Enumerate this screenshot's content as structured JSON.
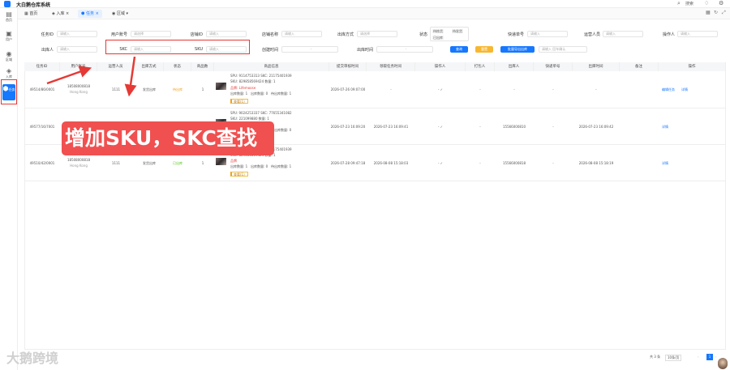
{
  "app": {
    "title": "大白鹅仓库系统",
    "search_label": "搜索"
  },
  "sidebar": {
    "items": [
      {
        "label": "首页",
        "icon": "home-icon"
      },
      {
        "label": "用户",
        "icon": "user-icon"
      },
      {
        "label": "区域",
        "icon": "location-icon"
      },
      {
        "label": "入库",
        "icon": "box-icon"
      },
      {
        "label": "任务",
        "icon": "task-icon"
      }
    ]
  },
  "tabs": [
    {
      "label": "首页",
      "icon": "grid-icon"
    },
    {
      "label": "入库",
      "icon": "box-icon"
    },
    {
      "label": "任务",
      "icon": "task-icon",
      "active": true
    },
    {
      "label": "区域",
      "icon": "location-icon"
    }
  ],
  "filters": {
    "row1": [
      {
        "label": "任务ID",
        "placeholder": "请输入"
      },
      {
        "label": "用户账号",
        "placeholder": "请选择"
      },
      {
        "label": "店铺ID",
        "placeholder": "请输入"
      },
      {
        "label": "店铺名称",
        "placeholder": "请输入"
      },
      {
        "label": "出库方式",
        "placeholder": "请选择"
      },
      {
        "label": "状态",
        "placeholder": ""
      },
      {
        "label": "快递单号",
        "placeholder": "请输入"
      },
      {
        "label": "运营人员",
        "placeholder": "请输入"
      },
      {
        "label": "操作人",
        "placeholder": "请输入"
      }
    ],
    "status_tags": [
      "待拣货",
      "待发货",
      "已出库"
    ],
    "row2": [
      {
        "label": "出库人",
        "placeholder": "请输入"
      },
      {
        "label": "SKC",
        "placeholder": "请输入"
      },
      {
        "label": "SKU",
        "placeholder": "请输入"
      },
      {
        "label": "创建时间",
        "placeholder": "-"
      },
      {
        "label": "出库时间",
        "placeholder": "-"
      }
    ],
    "search_button": "查询",
    "reset_button": "重置",
    "export_button": "批量导出出库",
    "extra_placeholder": "请输入 回车确认"
  },
  "table": {
    "headers": [
      "任务ID",
      "用户账号",
      "运营人员",
      "出库方式",
      "状态",
      "商品数",
      "商品信息",
      "提交审核时间",
      "领取任务时间",
      "操作人",
      "打包人",
      "出库人",
      "快递单号",
      "出库时间",
      "备注",
      "操作"
    ],
    "rows": [
      {
        "id": "49514/86/0001",
        "account": "18508000818",
        "account_sub": "Hong Kong",
        "operator": "1111",
        "method": "发货出库",
        "status": "待出库",
        "count": "1",
        "spu": "SPU: 9114753313",
        "skc": "SKC: 21175401939",
        "sku": "SKU: 829858569424",
        "qty": "数量: 1",
        "brand": "品牌: Lifemoose",
        "stock1": "出库数量: 1",
        "stock2": "出库数量: 0",
        "stock3": "待出库数量: 1",
        "note": "查看(1)",
        "submit": "2026-07-26 09:07:00",
        "claim": "-",
        "opr": "- ✓",
        "packer": "-",
        "outer": "-",
        "express": "-",
        "outtime": "-",
        "remark": "",
        "actions": [
          "编辑任务",
          "详情"
        ]
      },
      {
        "id": "49577/16/7001",
        "account": "18508000818",
        "account_sub": "Hong Kong",
        "operator": "1111",
        "method": "发货出库",
        "status": "已出库",
        "count": "1",
        "spu": "SPU: 9024253337",
        "skc": "SKC: 77655341082",
        "sku": "SKU: 221099880",
        "qty": "数量: 1",
        "brand": "品牌: Lifemoose",
        "stock1": "出库数量: 1",
        "stock2": "出库数量: 0",
        "stock3": "待出库数量: 0",
        "note": "查看详情",
        "submit": "2026-07-23 16:09:20",
        "claim": "2026-07-23 16:09:41",
        "opr": "- ✓",
        "packer": "-",
        "outer": "15566000810",
        "express": "-",
        "outtime": "2026-07-23 16:09:42",
        "remark": "",
        "actions": [
          "详情"
        ]
      },
      {
        "id": "49510/42/0001",
        "account": "18508000818",
        "account_sub": "Hong Kong",
        "operator": "1111",
        "method": "发货出库",
        "status": "已出库",
        "count": "1",
        "spu": "SPU: 9114753313",
        "skc": "SKC: 21175401939",
        "sku": "SKU: 829858569424",
        "qty": "数量: 1",
        "brand": "品牌",
        "stock1": "出库数量: 1",
        "stock2": "出库数量: 0",
        "stock3": "待出库数量: 1",
        "note": "查看(1)",
        "submit": "2026-07-28 09:47:18",
        "claim": "2026-08-08 15:18:03",
        "opr": "- ✓",
        "packer": "-",
        "outer": "15566000818",
        "express": "-",
        "outtime": "2026-08-08 15:18:19",
        "remark": "",
        "actions": [
          "详情"
        ]
      }
    ]
  },
  "pagination": {
    "total": "共 3 条",
    "page_size": "10条/页",
    "current": "1"
  },
  "annotation": {
    "text": "增加SKU，SKC查找",
    "color": "#f05050"
  },
  "watermark": "大鹅跨境",
  "colors": {
    "primary": "#1677ff",
    "highlight": "#e53935",
    "warning": "#f0a020",
    "success": "#52c41a"
  }
}
